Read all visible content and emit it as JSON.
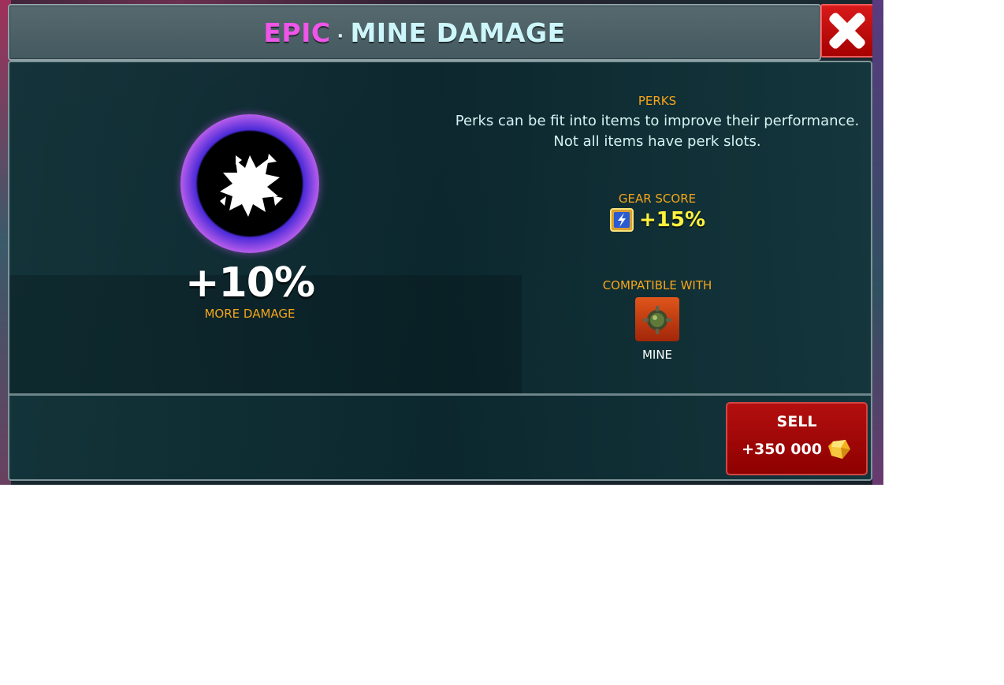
{
  "header": {
    "rarity": "EPIC",
    "separator": "·",
    "item_name": "MINE DAMAGE"
  },
  "perk": {
    "value": "+10%",
    "caption": "MORE DAMAGE",
    "icon": "explosion-icon",
    "rarity_color": "#ee55e8"
  },
  "info": {
    "perks_label": "PERKS",
    "perks_description": "Perks can be fit into items to improve their performance. Not all items have perk slots.",
    "gear_score_label": "GEAR SCORE",
    "gear_score_value": "+15%",
    "compatible_label": "COMPATIBLE WITH",
    "compatible_item": "MINE"
  },
  "sell": {
    "label": "SELL",
    "price": "+350 000",
    "currency_icon": "gold-gem-icon"
  },
  "close_icon": "close-icon"
}
